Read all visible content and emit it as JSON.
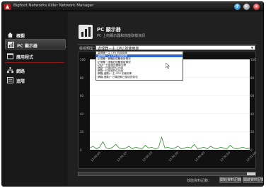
{
  "window": {
    "title": "Bigfoot Networks Killer Network Manager",
    "buttons": [
      "?",
      "–",
      "×"
    ]
  },
  "sidebar": {
    "items": [
      {
        "label": "概觀",
        "icon": "home-icon",
        "active": false
      },
      {
        "label": "PC 顯示器",
        "icon": "bar-chart-icon",
        "active": true
      },
      {
        "label": "應用程式",
        "icon": "window-icon",
        "active": false
      },
      {
        "label": "網路",
        "icon": "network-icon",
        "active": false
      },
      {
        "label": "進階",
        "icon": "list-icon",
        "active": false
      }
    ]
  },
  "header": {
    "title": "PC 顯示器",
    "subtitle": "PC 上的顯示器和效能取樣資訊"
  },
  "display": {
    "label": "檢視類型：",
    "selected": "處理器－主 CPU 的使用率",
    "options": [
      "處理器－主 CPU 的使用率",
      "處理器－主 CPU 的使用率",
      "記憶體－實體記憶體使用情況",
      "記憶體－虛擬記憶體使用情況",
      "Disk－已使用的硬碟空間",
      "網路－已傳送的位元組",
      "網路－已接收的位元組",
      "網路(進階)－主 CPU 的使用率",
      "網路(進階)－已傳送和已接收的封包"
    ],
    "selected_index": 1
  },
  "chart_data": {
    "type": "line",
    "y_ticks_left": [
      "100",
      "80",
      "60",
      "40",
      "20",
      "0"
    ],
    "y_ticks_right": [
      "100",
      "80",
      "60",
      "40",
      "20",
      "0"
    ],
    "ylim": [
      0,
      100
    ],
    "x_ticks": [
      "12:00:00",
      "12:00:10",
      "12:00:20",
      "12:00:30",
      "12:00:40",
      "12:00:50",
      "12:01:00"
    ],
    "series": [
      {
        "values": [
          2,
          4,
          1,
          3,
          9,
          2,
          1,
          3,
          6,
          2,
          1,
          2,
          4,
          1,
          3,
          2,
          1,
          5,
          2,
          3,
          1,
          2,
          14,
          2,
          3,
          1,
          2,
          4,
          1,
          2,
          3,
          2,
          6,
          1,
          2,
          3,
          1,
          4,
          2,
          1,
          3,
          2,
          1,
          5,
          2,
          1,
          2,
          3,
          1,
          2
        ],
        "color": "#2e8b2e"
      }
    ]
  },
  "footer": {
    "save_label": "效能資料記錄：",
    "buttons": [
      "開始資料記錄",
      "開啟資料記錄"
    ]
  }
}
